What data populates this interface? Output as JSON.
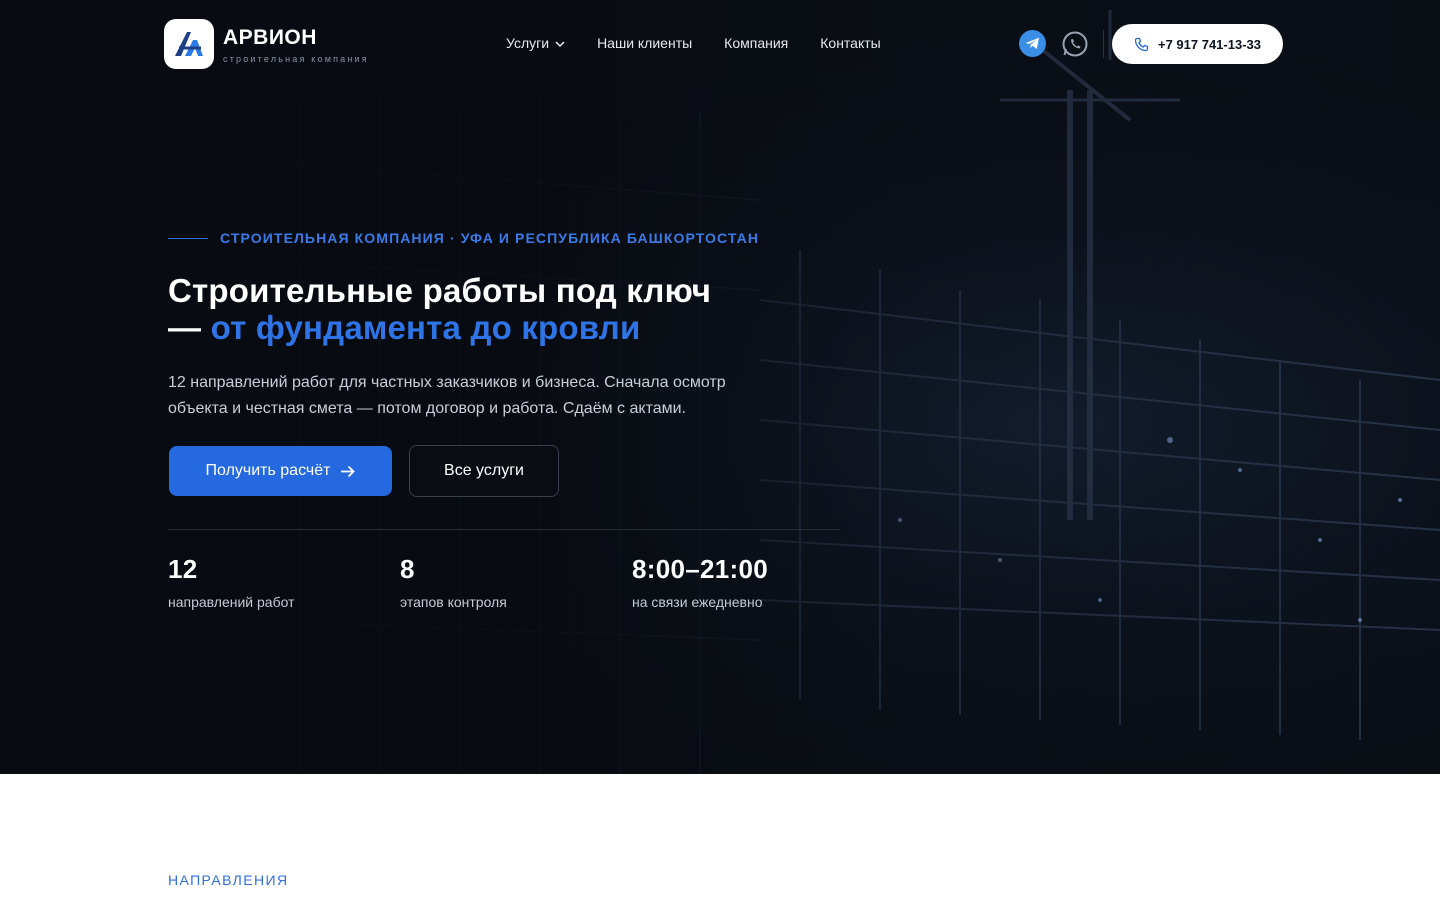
{
  "header": {
    "brand_name": "АРВИОН",
    "brand_subtitle": "СТРОИТЕЛЬНАЯ КОМПАНИЯ",
    "nav": [
      {
        "label": "Услуги",
        "has_dropdown": true
      },
      {
        "label": "Наши клиенты"
      },
      {
        "label": "Компания"
      },
      {
        "label": "Контакты"
      }
    ],
    "messengers": [
      "telegram-icon",
      "whatsapp-icon"
    ],
    "phone": "+7 917 741-13-33"
  },
  "hero": {
    "eyebrow": "СТРОИТЕЛЬНАЯ КОМПАНИЯ · УФА И РЕСПУБЛИКА БАШКОРТОСТАН",
    "headline_line1": "Строительные работы под ключ",
    "headline_dash": "— ",
    "headline_accent": "от фундамента до кровли",
    "lead_line1": "12 направлений работ для частных заказчиков и бизнеса. Сначала осмотр",
    "lead_line2": "объекта и честная смета — потом договор и работа. Сдаём с актами.",
    "primary_cta": "Получить расчёт",
    "secondary_cta": "Все услуги",
    "stats": [
      {
        "value": "12",
        "label": "направлений работ"
      },
      {
        "value": "8",
        "label": "этапов контроля"
      },
      {
        "value": "8:00–21:00",
        "label": "на связи ежедневно"
      }
    ]
  },
  "next_section": {
    "label": "НАПРАВЛЕНИЯ"
  },
  "colors": {
    "accent": "#2469df",
    "accent_text": "#2f74e6",
    "hero_bg": "#0b1018",
    "telegram": "#3a8ee6"
  }
}
